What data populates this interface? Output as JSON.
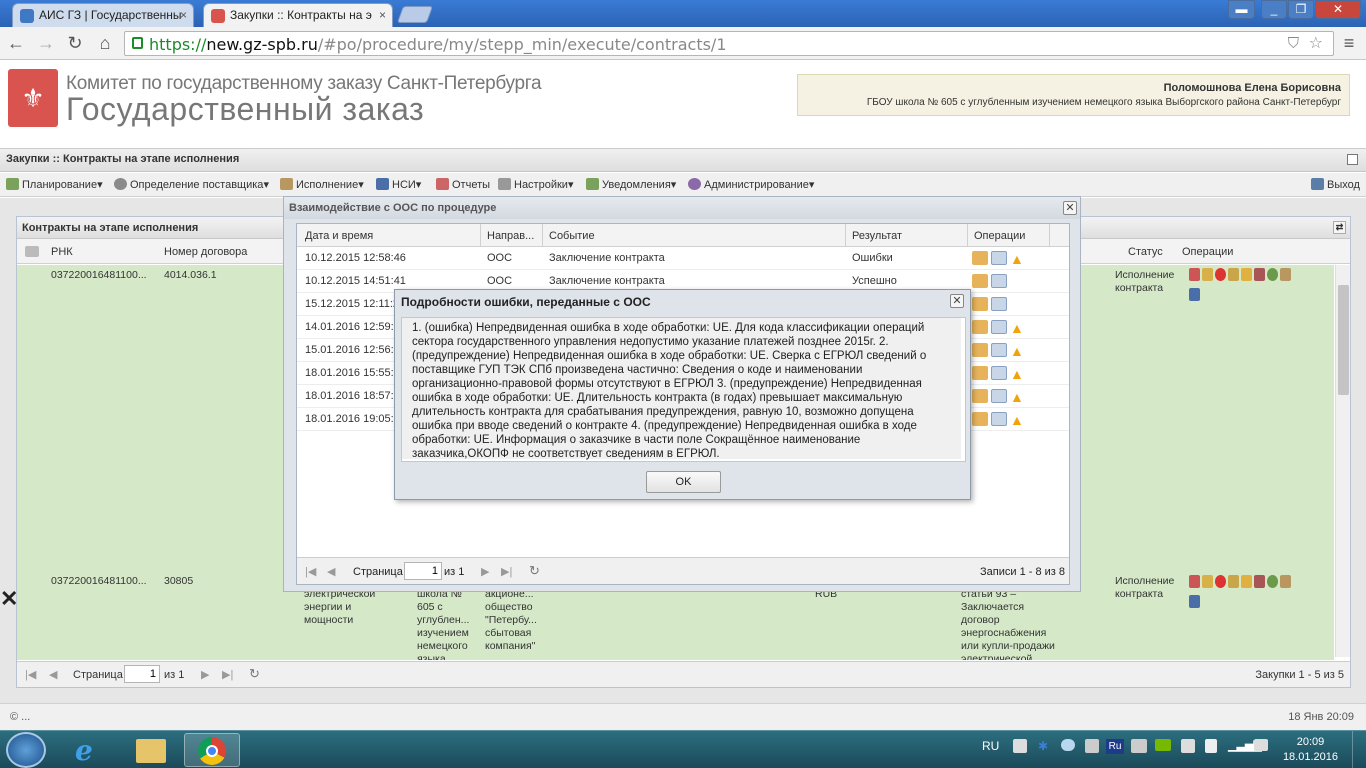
{
  "browser": {
    "tabs": [
      {
        "title": "АИС ГЗ | Государственны",
        "active": false
      },
      {
        "title": "Закупки :: Контракты на э",
        "active": true
      }
    ],
    "url_scheme": "https://",
    "url_host": "new.gz-spb.ru",
    "url_path": "/#po/procedure/my/stepp_min/execute/contracts/1"
  },
  "header": {
    "org_line1": "Комитет по государственному заказу Санкт-Петербурга",
    "org_line2": "Государственный заказ",
    "user_name": "Поломошнова Елена Борисовна",
    "user_org": "ГБОУ школа № 605 с углубленным изучением немецкого языка Выборгского района Санкт-Петербург"
  },
  "app_title": "Закупки :: Контракты на этапе исполнения",
  "menu": {
    "items": [
      "Планирование",
      "Определение поставщика",
      "Исполнение",
      "НСИ",
      "Отчеты",
      "Настройки",
      "Уведомления",
      "Администрирование"
    ],
    "exit": "Выход"
  },
  "grid": {
    "title": "Контракты на этапе исполнения",
    "columns": {
      "rnk": "РНК",
      "contract_no": "Номер договора",
      "status": "Статус",
      "ops": "Операции"
    },
    "rows": [
      {
        "rnk": "037220016481100...",
        "contract_no": "4014.036.1",
        "status": "Исполнение контракта",
        "c3": "",
        "c4": "",
        "c5": "",
        "c6": "",
        "c7": ""
      },
      {
        "rnk": "037220016481100...",
        "contract_no": "30805",
        "status": "Исполнение контракта",
        "c3": "электрической энергии и мощности",
        "c4": "школа № 605 с углублен... изучением немецкого языка",
        "c5": "акционе... общество \"Петербу... сбытовая компания\"",
        "c6": "RUB",
        "c7": "статьи 93 – Заключается договор энергоснабжения или купли-продажи электрической"
      }
    ],
    "pager": {
      "page_label": "Страница",
      "page": "1",
      "of": "из 1",
      "summary": "Закупки 1 - 5 из 5"
    }
  },
  "footer": {
    "left": "© ...",
    "right": "18 Янв 20:09"
  },
  "interaction_window": {
    "title": "Взаимодействие с ООС по процедуре",
    "columns": {
      "datetime": "Дата и время",
      "direction": "Направ...",
      "event": "Событие",
      "result": "Результат",
      "ops": "Операции"
    },
    "rows": [
      {
        "datetime": "10.12.2015 12:58:46",
        "direction": "ООС",
        "event": "Заключение контракта",
        "result": "Ошибки",
        "warn": true
      },
      {
        "datetime": "10.12.2015 14:51:41",
        "direction": "ООС",
        "event": "Заключение контракта",
        "result": "Успешно",
        "warn": false
      },
      {
        "datetime": "15.12.2015 12:11:2",
        "direction": "",
        "event": "",
        "result": "",
        "warn": false
      },
      {
        "datetime": "14.01.2016 12:59:3",
        "direction": "",
        "event": "",
        "result": "",
        "warn": true
      },
      {
        "datetime": "15.01.2016 12:56:0",
        "direction": "",
        "event": "",
        "result": "",
        "warn": true
      },
      {
        "datetime": "18.01.2016 15:55:0",
        "direction": "",
        "event": "",
        "result": "",
        "warn": true
      },
      {
        "datetime": "18.01.2016 18:57:0",
        "direction": "",
        "event": "",
        "result": "",
        "warn": true
      },
      {
        "datetime": "18.01.2016 19:05:3",
        "direction": "",
        "event": "",
        "result": "",
        "warn": true
      }
    ],
    "pager": {
      "page_label": "Страница",
      "page": "1",
      "of": "из 1",
      "summary": "Записи 1 - 8 из 8"
    }
  },
  "error_dialog": {
    "title": "Подробности ошибки, переданные с ООС",
    "text": "1. (ошибка) Непредвиденная ошибка в ходе обработки: UE. Для кода классификации операций сектора государственного управления недопустимо указание платежей позднее 2015г. 2. (предупреждение) Непредвиденная ошибка в ходе обработки: UE. Сверка с ЕГРЮЛ сведений о поставщике ГУП ТЭК СПб произведена частично: Сведения о коде и наименовании организационно-правовой формы отсутствуют в ЕГРЮЛ 3. (предупреждение) Непредвиденная ошибка в ходе обработки: UE. Длительность контракта (в годах) превышает максимальную длительность контракта для срабатывания предупреждения, равную 10, возможно допущена ошибка при вводе сведений о контракте 4. (предупреждение) Непредвиденная ошибка в ходе обработки: UE. Информация о заказчике в части поле Сокращённое наименование заказчика,ОКОПФ не соответствует сведениям в ЕГРЮЛ.",
    "ok": "OK"
  },
  "taskbar": {
    "lang": "RU",
    "time": "20:09",
    "date": "18.01.2016"
  },
  "colors": {
    "row_green": "#d5e9c8",
    "warn": "#f0a30a",
    "brand_red": "#d9534f"
  }
}
